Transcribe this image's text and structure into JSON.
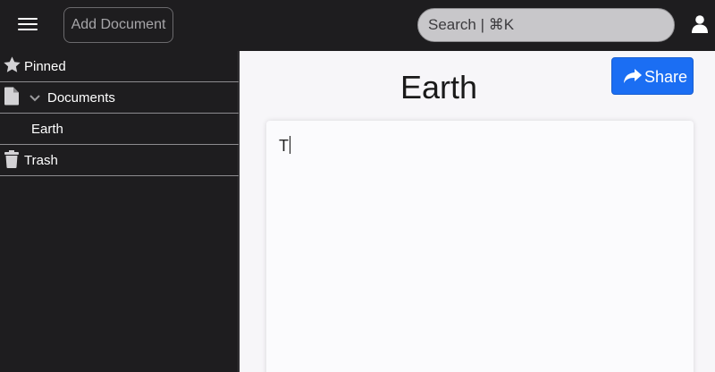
{
  "topbar": {
    "add_document_label": "Add Document",
    "search_label": "Search | ⌘K",
    "menu_icon": "hamburger-icon",
    "user_icon": "user-icon"
  },
  "sidebar": {
    "items": [
      {
        "label": "Pinned",
        "icon": "star-icon"
      },
      {
        "label": "Documents",
        "icon": "document-icon",
        "expanded": true
      },
      {
        "label": "Earth",
        "indent": true
      },
      {
        "label": "Trash",
        "icon": "trash-icon"
      }
    ]
  },
  "document": {
    "title": "Earth",
    "share_label": "Share",
    "content": "T"
  },
  "colors": {
    "chrome": "#1e1d1f",
    "accent": "#1b6ef3",
    "canvas": "#f7f6f9"
  }
}
